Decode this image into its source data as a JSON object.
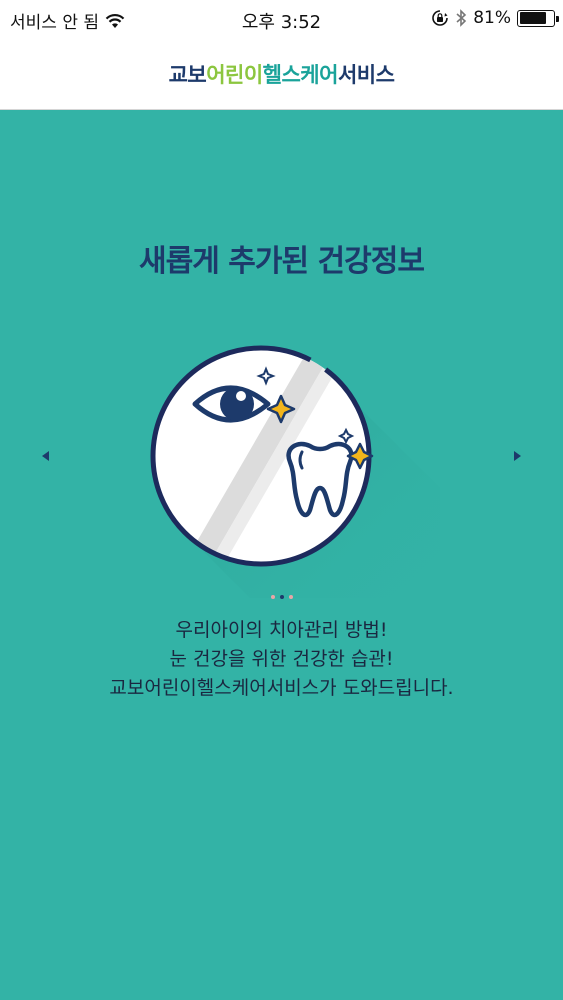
{
  "status_bar": {
    "carrier": "서비스 안 됨",
    "time": "오후 3:52",
    "battery": "81%",
    "battery_level": 0.81
  },
  "header": {
    "logo_parts": [
      {
        "text": "교보",
        "color": "#1d3a6b"
      },
      {
        "text": "어린이",
        "color": "#8cc63f"
      },
      {
        "text": "헬스케어",
        "color": "#1aa39a"
      },
      {
        "text": "서비스",
        "color": "#1d3a6b"
      }
    ]
  },
  "main": {
    "title": "새롭게 추가된 건강정보",
    "description": [
      "우리아이의 치아관리 방법!",
      "눈 건강을 위한 건강한 습관!",
      "교보어린이헬스케어서비스가 도와드립니다."
    ],
    "carousel": {
      "total": 3,
      "active_index": 1
    }
  },
  "colors": {
    "background": "#33b3a6",
    "navy": "#1d3a6b",
    "accent_yellow": "#f3b51b"
  },
  "icons": [
    "wifi-icon",
    "lock-rotation-icon",
    "bluetooth-icon",
    "battery-icon",
    "eye-icon",
    "tooth-icon",
    "sparkle-icon",
    "arrow-left-icon",
    "arrow-right-icon"
  ]
}
